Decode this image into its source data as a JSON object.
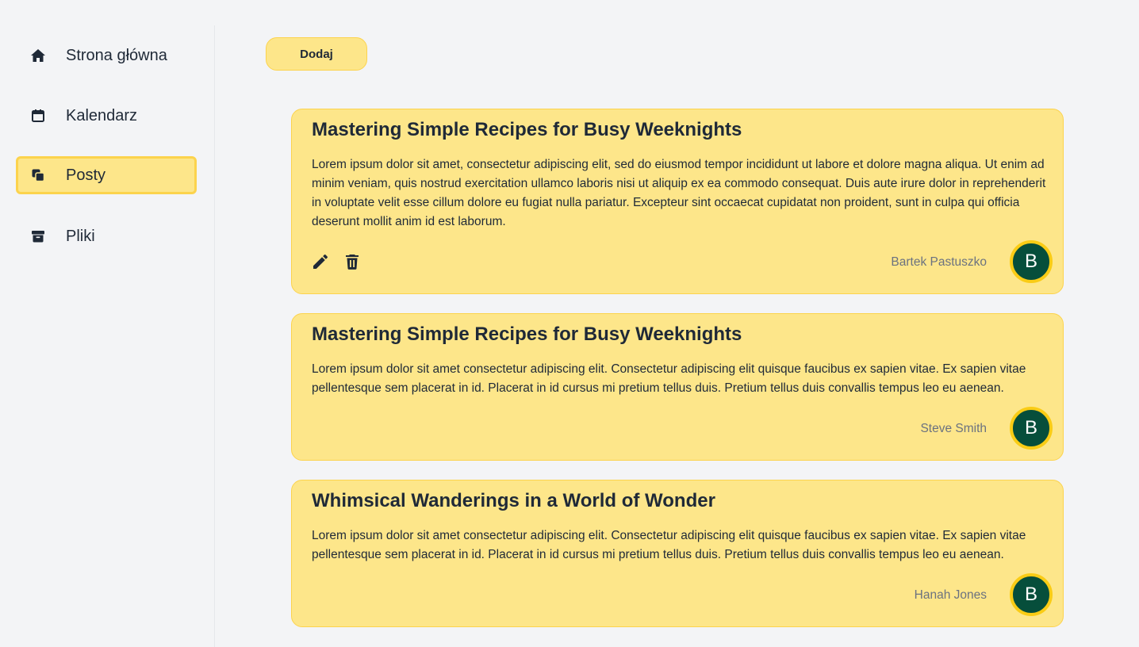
{
  "sidebar": {
    "items": [
      {
        "label": "Strona główna",
        "icon": "home-icon"
      },
      {
        "label": "Kalendarz",
        "icon": "calendar-icon"
      },
      {
        "label": "Posty",
        "icon": "copy-icon",
        "active": true
      },
      {
        "label": "Pliki",
        "icon": "archive-icon"
      }
    ]
  },
  "toolbar": {
    "add_label": "Dodaj"
  },
  "posts": [
    {
      "title": "Mastering Simple Recipes for Busy Weeknights",
      "body": "Lorem ipsum dolor sit amet, consectetur adipiscing elit, sed do eiusmod tempor incididunt ut labore et dolore magna aliqua. Ut enim ad minim veniam, quis nostrud exercitation ullamco laboris nisi ut aliquip ex ea commodo consequat. Duis aute irure dolor in reprehenderit in voluptate velit esse cillum dolore eu fugiat nulla pariatur. Excepteur sint occaecat cupidatat non proident, sunt in culpa qui officia deserunt mollit anim id est laborum.",
      "author": "Bartek Pastuszko",
      "avatar_letter": "B",
      "actions": [
        "edit-icon",
        "trash-icon"
      ]
    },
    {
      "title": "Mastering Simple Recipes for Busy Weeknights",
      "body": "Lorem ipsum dolor sit amet consectetur adipiscing elit. Consectetur adipiscing elit quisque faucibus ex sapien vitae. Ex sapien vitae pellentesque sem placerat in id. Placerat in id cursus mi pretium tellus duis. Pretium tellus duis convallis tempus leo eu aenean.",
      "author": "Steve Smith",
      "avatar_letter": "B"
    },
    {
      "title": "Whimsical Wanderings in a World of Wonder",
      "body": "Lorem ipsum dolor sit amet consectetur adipiscing elit. Consectetur adipiscing elit quisque faucibus ex sapien vitae. Ex sapien vitae pellentesque sem placerat in id. Placerat in id cursus mi pretium tellus duis. Pretium tellus duis convallis tempus leo eu aenean.",
      "author": "Hanah Jones",
      "avatar_letter": "B"
    }
  ],
  "colors": {
    "card_bg": "#fde68a",
    "card_border": "#fcd34d",
    "avatar_bg": "#064e3b",
    "avatar_ring": "#facc15",
    "page_bg": "#f3f4f6"
  }
}
